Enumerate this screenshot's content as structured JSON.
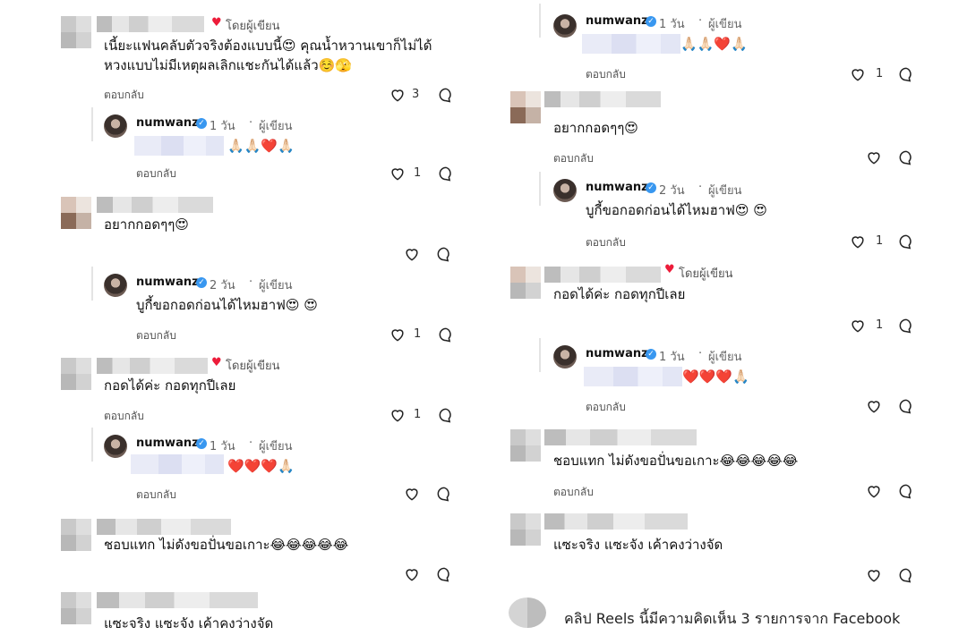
{
  "labels": {
    "reply": "ตอบกลับ",
    "by_author": "โดยผู้เขียน",
    "author_tag": "ผู้เขียน"
  },
  "left": {
    "c1": {
      "line1": "เนี้ยะแฟนคลับตัวจริงต้องแบบนี้😍 คุณน้ำหวานเขาก็ไม่ได้",
      "line2": "หวงแบบไม่มีเหตุผลเลิกแชะกันได้แล้ว☺️🫣",
      "likes": "3"
    },
    "r1": {
      "username": "numwanz",
      "time": "1 วัน",
      "emojis": "🙏🏻🙏🏻❤️🙏🏻",
      "likes": "1"
    },
    "c2": {
      "text": "อยากกอดๆๆ😍"
    },
    "r2": {
      "username": "numwanz",
      "time": "2 วัน",
      "text": "บูกี้ขอกอดก่อนได้ไหมฮาฟ😍 😍",
      "likes": "1"
    },
    "c3": {
      "text": "กอดได้ค่ะ กอดทุกปีเลย",
      "likes": "1"
    },
    "r3": {
      "username": "numwanz",
      "time": "1 วัน",
      "emojis": "❤️❤️❤️🙏🏻"
    },
    "c4": {
      "text": "ชอบแทก ไม่ดังขอปั่นขอเกาะ😂😂😂😂😂"
    },
    "c5": {
      "text": "แซะจริง แซะจัง เค้าคงว่างจัด"
    }
  },
  "right": {
    "r0": {
      "username": "numwanz",
      "time": "1 วัน",
      "emojis": "🙏🏻🙏🏻❤️🙏🏻",
      "likes": "1"
    },
    "c2": {
      "text": "อยากกอดๆๆ😍"
    },
    "r2": {
      "username": "numwanz",
      "time": "2 วัน",
      "text": "บูกี้ขอกอดก่อนได้ไหมฮาฟ😍 😍",
      "likes": "1"
    },
    "c3": {
      "text": "กอดได้ค่ะ กอดทุกปีเลย",
      "likes": "1"
    },
    "r3": {
      "username": "numwanz",
      "time": "1 วัน",
      "emojis": "❤️❤️❤️🙏🏻"
    },
    "c4": {
      "text": "ชอบแทก ไม่ดังขอปั่นขอเกาะ😂😂😂😂😂"
    },
    "c5": {
      "text": "แซะจริง แซะจัง เค้าคงว่างจัด"
    },
    "footer": "คลิป Reels นี้มีความคิดเห็น 3 รายการจาก Facebook"
  },
  "colors": {
    "heart_red": "#ed1c3a",
    "verified_blue": "#3897f0"
  },
  "icons": {
    "like": "heart-outline-icon",
    "reply_bubble": "speech-bubble-icon",
    "verified": "verified-badge-icon",
    "author_heart": "heart-filled-icon"
  }
}
